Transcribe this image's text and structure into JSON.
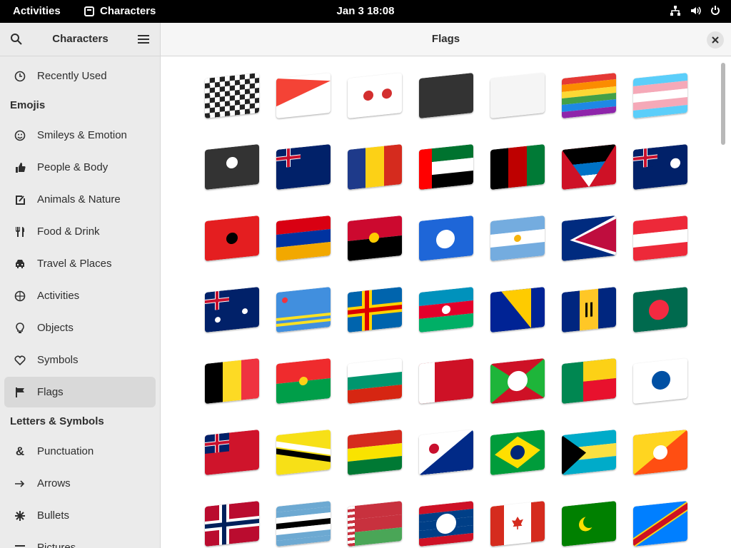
{
  "topbar": {
    "activities": "Activities",
    "app_name": "Characters",
    "clock": "Jan 3  18:08"
  },
  "sidebar": {
    "title": "Characters",
    "recent": "Recently Used",
    "emojis_header": "Emojis",
    "emoji_items": [
      {
        "label": "Smileys & Emotion",
        "icon": "smiley-icon"
      },
      {
        "label": "People & Body",
        "icon": "thumbs-up-icon"
      },
      {
        "label": "Animals & Nature",
        "icon": "paw-icon"
      },
      {
        "label": "Food & Drink",
        "icon": "cutlery-icon"
      },
      {
        "label": "Travel & Places",
        "icon": "car-icon"
      },
      {
        "label": "Activities",
        "icon": "clock-icon"
      },
      {
        "label": "Objects",
        "icon": "lightbulb-icon"
      },
      {
        "label": "Symbols",
        "icon": "symbols-icon"
      },
      {
        "label": "Flags",
        "icon": "flag-icon"
      }
    ],
    "letters_header": "Letters & Symbols",
    "letter_items": [
      {
        "label": "Punctuation",
        "icon": "ampersand-icon"
      },
      {
        "label": "Arrows",
        "icon": "arrow-icon"
      },
      {
        "label": "Bullets",
        "icon": "bullet-icon"
      },
      {
        "label": "Pictures",
        "icon": "picture-icon"
      }
    ]
  },
  "main": {
    "title": "Flags",
    "flags": [
      {
        "name": "chequered-flag"
      },
      {
        "name": "triangular-flag"
      },
      {
        "name": "crossed-flags"
      },
      {
        "name": "black-flag"
      },
      {
        "name": "white-flag"
      },
      {
        "name": "rainbow-flag"
      },
      {
        "name": "transgender-flag"
      },
      {
        "name": "pirate-flag"
      },
      {
        "name": "ascension-island"
      },
      {
        "name": "andorra"
      },
      {
        "name": "united-arab-emirates"
      },
      {
        "name": "afghanistan"
      },
      {
        "name": "antigua-barbuda"
      },
      {
        "name": "anguilla"
      },
      {
        "name": "albania"
      },
      {
        "name": "armenia"
      },
      {
        "name": "angola"
      },
      {
        "name": "antarctica"
      },
      {
        "name": "argentina"
      },
      {
        "name": "american-samoa"
      },
      {
        "name": "austria"
      },
      {
        "name": "australia"
      },
      {
        "name": "aruba"
      },
      {
        "name": "aland-islands"
      },
      {
        "name": "azerbaijan"
      },
      {
        "name": "bosnia-herzegovina"
      },
      {
        "name": "barbados"
      },
      {
        "name": "bangladesh"
      },
      {
        "name": "belgium"
      },
      {
        "name": "burkina-faso"
      },
      {
        "name": "bulgaria"
      },
      {
        "name": "bahrain"
      },
      {
        "name": "burundi"
      },
      {
        "name": "benin"
      },
      {
        "name": "st-barthelemy"
      },
      {
        "name": "bermuda"
      },
      {
        "name": "brunei"
      },
      {
        "name": "bolivia"
      },
      {
        "name": "caribbean-netherlands"
      },
      {
        "name": "brazil"
      },
      {
        "name": "bahamas"
      },
      {
        "name": "bhutan"
      },
      {
        "name": "bouvet-island"
      },
      {
        "name": "botswana"
      },
      {
        "name": "belarus"
      },
      {
        "name": "belize"
      },
      {
        "name": "canada"
      },
      {
        "name": "cocos-islands"
      },
      {
        "name": "congo-kinshasa"
      }
    ]
  }
}
